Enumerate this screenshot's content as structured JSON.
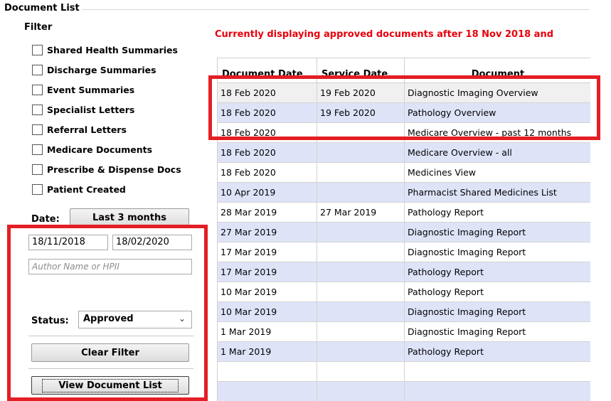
{
  "panel": {
    "title": "Document List",
    "filter_title": "Filter",
    "checkboxes": [
      {
        "label": "Shared Health Summaries",
        "checked": false
      },
      {
        "label": "Discharge Summaries",
        "checked": false
      },
      {
        "label": "Event Summaries",
        "checked": false
      },
      {
        "label": "Specialist Letters",
        "checked": false
      },
      {
        "label": "Referral Letters",
        "checked": false
      },
      {
        "label": "Medicare Documents",
        "checked": false
      },
      {
        "label": "Prescribe & Dispense Docs",
        "checked": false
      },
      {
        "label": "Patient Created",
        "checked": false
      }
    ],
    "date_label": "Date:",
    "date_range_button": "Last 3 months",
    "date_from": "18/11/2018",
    "date_to": "18/02/2020",
    "author_placeholder": "Author Name or HPII",
    "status_label": "Status:",
    "status_value": "Approved",
    "clear_filter_label": "Clear Filter",
    "view_list_label": "View Document List"
  },
  "banner": "Currently displaying approved documents after 18 Nov 2018 and",
  "table": {
    "columns": [
      "Document Date",
      "Service Date",
      "Document"
    ],
    "rows": [
      {
        "doc_date": "18 Feb 2020",
        "service_date": "19 Feb 2020",
        "document": "Diagnostic Imaging Overview"
      },
      {
        "doc_date": "18 Feb 2020",
        "service_date": "19 Feb 2020",
        "document": "Pathology Overview"
      },
      {
        "doc_date": "18 Feb 2020",
        "service_date": "",
        "document": "Medicare Overview - past 12 months"
      },
      {
        "doc_date": "18 Feb 2020",
        "service_date": "",
        "document": "Medicare Overview - all"
      },
      {
        "doc_date": "18 Feb 2020",
        "service_date": "",
        "document": "Medicines View"
      },
      {
        "doc_date": "10 Apr 2019",
        "service_date": "",
        "document": "Pharmacist Shared Medicines List"
      },
      {
        "doc_date": "28 Mar 2019",
        "service_date": "27 Mar 2019",
        "document": "Pathology Report"
      },
      {
        "doc_date": "27 Mar 2019",
        "service_date": "",
        "document": "Diagnostic Imaging Report"
      },
      {
        "doc_date": "17 Mar 2019",
        "service_date": "",
        "document": "Diagnostic Imaging Report"
      },
      {
        "doc_date": "17 Mar 2019",
        "service_date": "",
        "document": "Pathology Report"
      },
      {
        "doc_date": "10 Mar 2019",
        "service_date": "",
        "document": "Pathology Report"
      },
      {
        "doc_date": "10 Mar 2019",
        "service_date": "",
        "document": "Diagnostic Imaging Report"
      },
      {
        "doc_date": "1 Mar 2019",
        "service_date": "",
        "document": "Diagnostic Imaging Report"
      },
      {
        "doc_date": "1 Mar 2019",
        "service_date": "",
        "document": "Pathology Report"
      },
      {
        "doc_date": "",
        "service_date": "",
        "document": ""
      },
      {
        "doc_date": "",
        "service_date": "",
        "document": ""
      }
    ]
  },
  "colors": {
    "highlight_box": "#e31e24",
    "banner_text": "#e8000b",
    "row_alt": "#dfe3f8"
  }
}
